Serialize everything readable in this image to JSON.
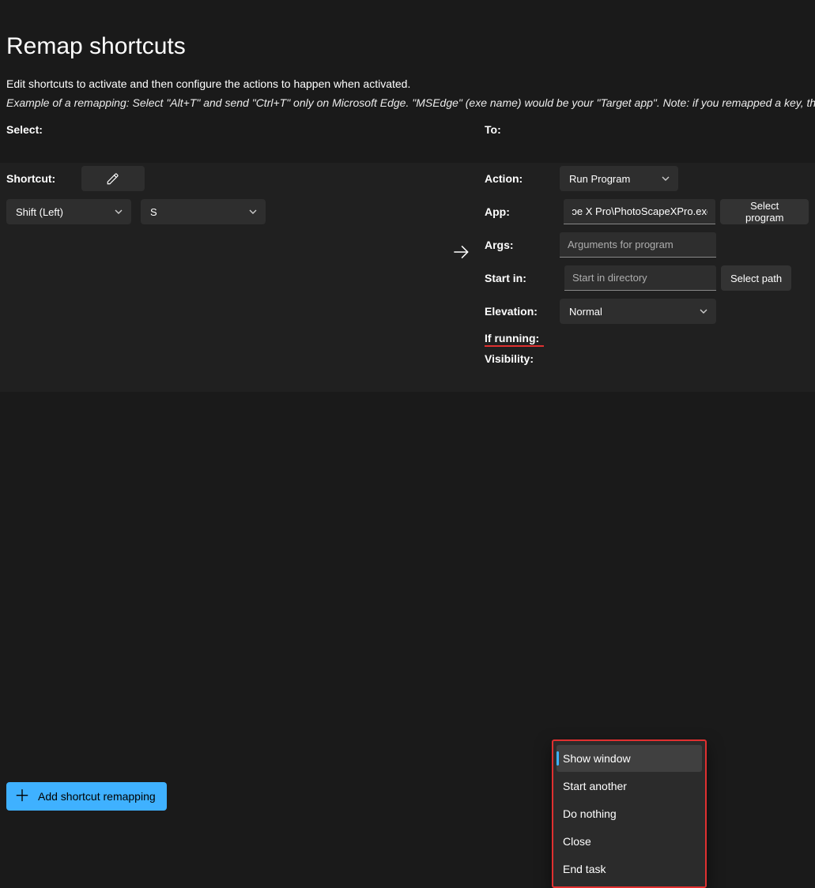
{
  "title": "Remap shortcuts",
  "description": "Edit shortcuts to activate and then configure the actions to happen when activated.",
  "example": "Example of a remapping: Select \"Alt+T\" and send \"Ctrl+T\" only on Microsoft Edge. \"MSEdge\" (exe name) would be your \"Target app\". Note: if you remapped a key, that wi",
  "left": {
    "header": "Select:",
    "shortcut_label": "Shortcut:",
    "key1": "Shift (Left)",
    "key2": "S"
  },
  "right": {
    "header": "To:",
    "action_label": "Action:",
    "action_value": "Run Program",
    "app_label": "App:",
    "app_value": "ɔe X Pro\\PhotoScapeXPro.exe",
    "select_program": "Select program",
    "args_label": "Args:",
    "args_placeholder": "Arguments for program",
    "startin_label": "Start in:",
    "startin_placeholder": "Start in directory",
    "select_path": "Select path",
    "elevation_label": "Elevation:",
    "elevation_value": "Normal",
    "ifrunning_label": "If running:",
    "visibility_label": "Visibility:"
  },
  "dropdown": {
    "items": [
      "Show window",
      "Start another",
      "Do nothing",
      "Close",
      "End task"
    ],
    "selected": "Show window"
  },
  "add_button": "Add shortcut remapping"
}
